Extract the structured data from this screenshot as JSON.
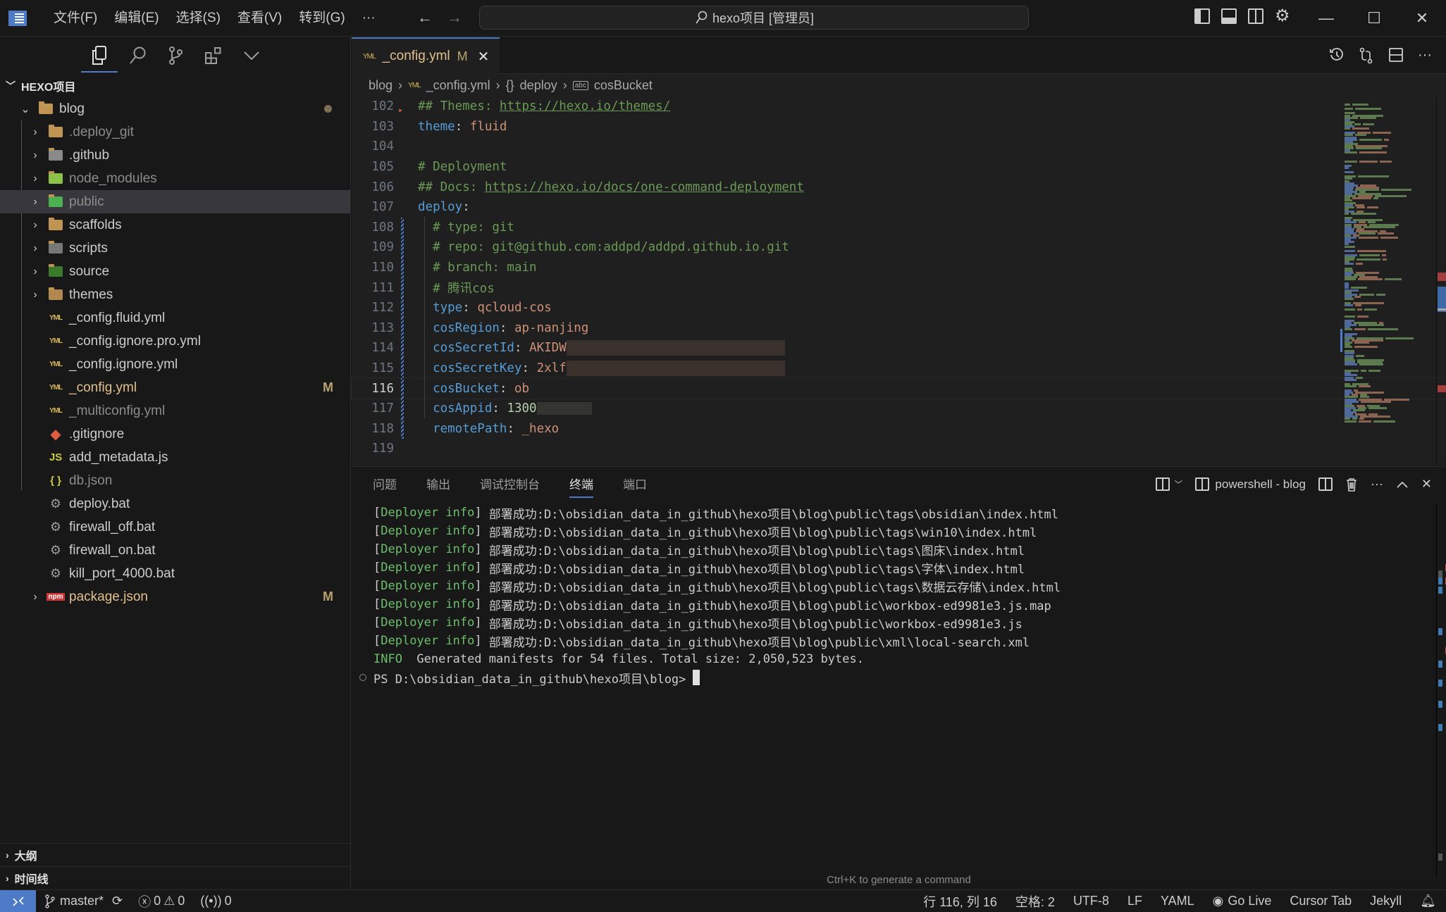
{
  "titlebar": {
    "menu": [
      "文件(F)",
      "编辑(E)",
      "选择(S)",
      "查看(V)",
      "转到(G)",
      "···"
    ],
    "search_text": "hexo项目 [管理员]",
    "back_arrow": "←",
    "forward_arrow": "→",
    "window_controls": {
      "minimize": "—",
      "maximize": "☐",
      "close": "✕"
    }
  },
  "sidebar": {
    "activity_icons": [
      "explorer-icon",
      "search-icon",
      "source-control-icon",
      "extensions-icon",
      "chevron-down-icon"
    ],
    "root_label": "HEXO项目",
    "tree": [
      {
        "name": "blog",
        "type": "folder-open",
        "status": "normal",
        "decoration": "dot",
        "depth": 0
      },
      {
        "name": ".deploy_git",
        "type": "folder",
        "status": "ignored",
        "depth": 1
      },
      {
        "name": ".github",
        "type": "folder-github",
        "status": "normal",
        "depth": 1
      },
      {
        "name": "node_modules",
        "type": "folder-node",
        "status": "ignored",
        "depth": 1
      },
      {
        "name": "public",
        "type": "folder-public",
        "status": "ignored",
        "depth": 1,
        "selected": true
      },
      {
        "name": "scaffolds",
        "type": "folder",
        "status": "normal",
        "depth": 1
      },
      {
        "name": "scripts",
        "type": "folder-scripts",
        "status": "normal",
        "depth": 1
      },
      {
        "name": "source",
        "type": "folder-source",
        "status": "normal",
        "depth": 1
      },
      {
        "name": "themes",
        "type": "folder-themes",
        "status": "normal",
        "depth": 1
      },
      {
        "name": "_config.fluid.yml",
        "type": "yml",
        "status": "normal",
        "depth": 1
      },
      {
        "name": "_config.ignore.pro.yml",
        "type": "yml",
        "status": "normal",
        "depth": 1
      },
      {
        "name": "_config.ignore.yml",
        "type": "yml",
        "status": "normal",
        "depth": 1
      },
      {
        "name": "_config.yml",
        "type": "yml",
        "status": "modified",
        "badge": "M",
        "depth": 1
      },
      {
        "name": "_multiconfig.yml",
        "type": "yml",
        "status": "ignored",
        "depth": 1
      },
      {
        "name": ".gitignore",
        "type": "git",
        "status": "normal",
        "depth": 1
      },
      {
        "name": "add_metadata.js",
        "type": "js",
        "status": "normal",
        "depth": 1
      },
      {
        "name": "db.json",
        "type": "json",
        "status": "ignored",
        "depth": 1
      },
      {
        "name": "deploy.bat",
        "type": "bat",
        "status": "normal",
        "depth": 1
      },
      {
        "name": "firewall_off.bat",
        "type": "bat",
        "status": "normal",
        "depth": 1
      },
      {
        "name": "firewall_on.bat",
        "type": "bat",
        "status": "normal",
        "depth": 1
      },
      {
        "name": "kill_port_4000.bat",
        "type": "bat",
        "status": "normal",
        "depth": 1
      },
      {
        "name": "package.json",
        "type": "npm",
        "status": "modified",
        "badge": "M",
        "depth": 1,
        "collapsible": true
      }
    ],
    "sections": [
      "大纲",
      "时间线"
    ]
  },
  "editor": {
    "tab": {
      "icon_text": "YML",
      "name": "_config.yml",
      "badge": "M",
      "close": "✕"
    },
    "breadcrumb": [
      "blog",
      "_config.yml",
      "deploy",
      "cosBucket"
    ],
    "current_line": 116,
    "lines": [
      {
        "n": 102,
        "tokens": [
          [
            "comment",
            "## Themes: "
          ],
          [
            "link",
            "https://hexo.io/themes/"
          ]
        ]
      },
      {
        "n": 103,
        "tokens": [
          [
            "key",
            "theme"
          ],
          [
            "punc",
            ": "
          ],
          [
            "str",
            "fluid"
          ]
        ]
      },
      {
        "n": 104,
        "tokens": []
      },
      {
        "n": 105,
        "tokens": [
          [
            "comment",
            "# Deployment"
          ]
        ]
      },
      {
        "n": 106,
        "tokens": [
          [
            "comment",
            "## Docs: "
          ],
          [
            "link",
            "https://hexo.io/docs/one-command-deployment"
          ]
        ]
      },
      {
        "n": 107,
        "tokens": [
          [
            "key",
            "deploy"
          ],
          [
            "punc",
            ":"
          ]
        ]
      },
      {
        "n": 108,
        "changed": true,
        "tokens": [
          [
            "punc",
            "  "
          ],
          [
            "comment",
            "# type: git"
          ]
        ]
      },
      {
        "n": 109,
        "changed": true,
        "tokens": [
          [
            "punc",
            "  "
          ],
          [
            "comment",
            "# repo: git@github.com:addpd/addpd.github.io.git"
          ]
        ]
      },
      {
        "n": 110,
        "changed": true,
        "tokens": [
          [
            "punc",
            "  "
          ],
          [
            "comment",
            "# branch: main"
          ]
        ]
      },
      {
        "n": 111,
        "changed": true,
        "tokens": [
          [
            "punc",
            "  "
          ],
          [
            "comment",
            "# 腾讯cos"
          ]
        ]
      },
      {
        "n": 112,
        "changed": true,
        "tokens": [
          [
            "punc",
            "  "
          ],
          [
            "key",
            "type"
          ],
          [
            "punc",
            ": "
          ],
          [
            "str",
            "qcloud-cos"
          ]
        ]
      },
      {
        "n": 113,
        "changed": true,
        "tokens": [
          [
            "punc",
            "  "
          ],
          [
            "key",
            "cosRegion"
          ],
          [
            "punc",
            ": "
          ],
          [
            "str",
            "ap-nanjing"
          ]
        ]
      },
      {
        "n": 114,
        "changed": true,
        "tokens": [
          [
            "punc",
            "  "
          ],
          [
            "key",
            "cosSecretId"
          ],
          [
            "punc",
            ": "
          ],
          [
            "str",
            "AKIDW"
          ],
          [
            "redact",
            ""
          ]
        ]
      },
      {
        "n": 115,
        "changed": true,
        "tokens": [
          [
            "punc",
            "  "
          ],
          [
            "key",
            "cosSecretKey"
          ],
          [
            "punc",
            ": "
          ],
          [
            "str",
            "2xlf"
          ],
          [
            "redact",
            ""
          ]
        ]
      },
      {
        "n": 116,
        "changed": true,
        "tokens": [
          [
            "punc",
            "  "
          ],
          [
            "key",
            "cosBucket"
          ],
          [
            "punc",
            ": "
          ],
          [
            "str",
            "ob"
          ]
        ]
      },
      {
        "n": 117,
        "changed": true,
        "tokens": [
          [
            "punc",
            "  "
          ],
          [
            "key",
            "cosAppid"
          ],
          [
            "punc",
            ": "
          ],
          [
            "num",
            "1300"
          ],
          [
            "redact2",
            ""
          ]
        ]
      },
      {
        "n": 118,
        "changed": true,
        "tokens": [
          [
            "punc",
            "  "
          ],
          [
            "key",
            "remotePath"
          ],
          [
            "punc",
            ": "
          ],
          [
            "str",
            "_hexo"
          ]
        ]
      },
      {
        "n": 119,
        "tokens": []
      }
    ]
  },
  "panel": {
    "tabs": [
      "问题",
      "输出",
      "调试控制台",
      "终端",
      "端口"
    ],
    "active_tab": "终端",
    "terminal_name": "powershell - blog",
    "lines": [
      {
        "tag": "Deployer info",
        "text": "部署成功:D:\\obsidian_data_in_github\\hexo项目\\blog\\public\\tags\\obsidian\\index.html"
      },
      {
        "tag": "Deployer info",
        "text": "部署成功:D:\\obsidian_data_in_github\\hexo项目\\blog\\public\\tags\\win10\\index.html"
      },
      {
        "tag": "Deployer info",
        "text": "部署成功:D:\\obsidian_data_in_github\\hexo项目\\blog\\public\\tags\\图床\\index.html"
      },
      {
        "tag": "Deployer info",
        "text": "部署成功:D:\\obsidian_data_in_github\\hexo项目\\blog\\public\\tags\\字体\\index.html"
      },
      {
        "tag": "Deployer info",
        "text": "部署成功:D:\\obsidian_data_in_github\\hexo项目\\blog\\public\\tags\\数据云存储\\index.html"
      },
      {
        "tag": "Deployer info",
        "text": "部署成功:D:\\obsidian_data_in_github\\hexo项目\\blog\\public\\workbox-ed9981e3.js.map"
      },
      {
        "tag": "Deployer info",
        "text": "部署成功:D:\\obsidian_data_in_github\\hexo项目\\blog\\public\\workbox-ed9981e3.js"
      },
      {
        "tag": "Deployer info",
        "text": "部署成功:D:\\obsidian_data_in_github\\hexo项目\\blog\\public\\xml\\local-search.xml"
      }
    ],
    "info_label": "INFO",
    "info_text": "Generated manifests for 54 files. Total size: 2,050,523 bytes.",
    "prompt": "PS D:\\obsidian_data_in_github\\hexo项目\\blog>",
    "hint": "Ctrl+K to generate a command"
  },
  "statusbar": {
    "branch": "master*",
    "errors": "0",
    "warnings": "0",
    "ports": "0",
    "position": "行 116, 列 16",
    "spaces": "空格: 2",
    "encoding": "UTF-8",
    "eol": "LF",
    "language": "YAML",
    "go_live": "Go Live",
    "cursor_tab": "Cursor Tab",
    "jekyll": "Jekyll"
  },
  "colors": {
    "accent": "#4d7bc8",
    "modified": "#e2c08d",
    "ignored": "#8c8c8c",
    "comment": "#6a9955",
    "key": "#569cd6",
    "string": "#ce9178",
    "number": "#b5cea8"
  }
}
